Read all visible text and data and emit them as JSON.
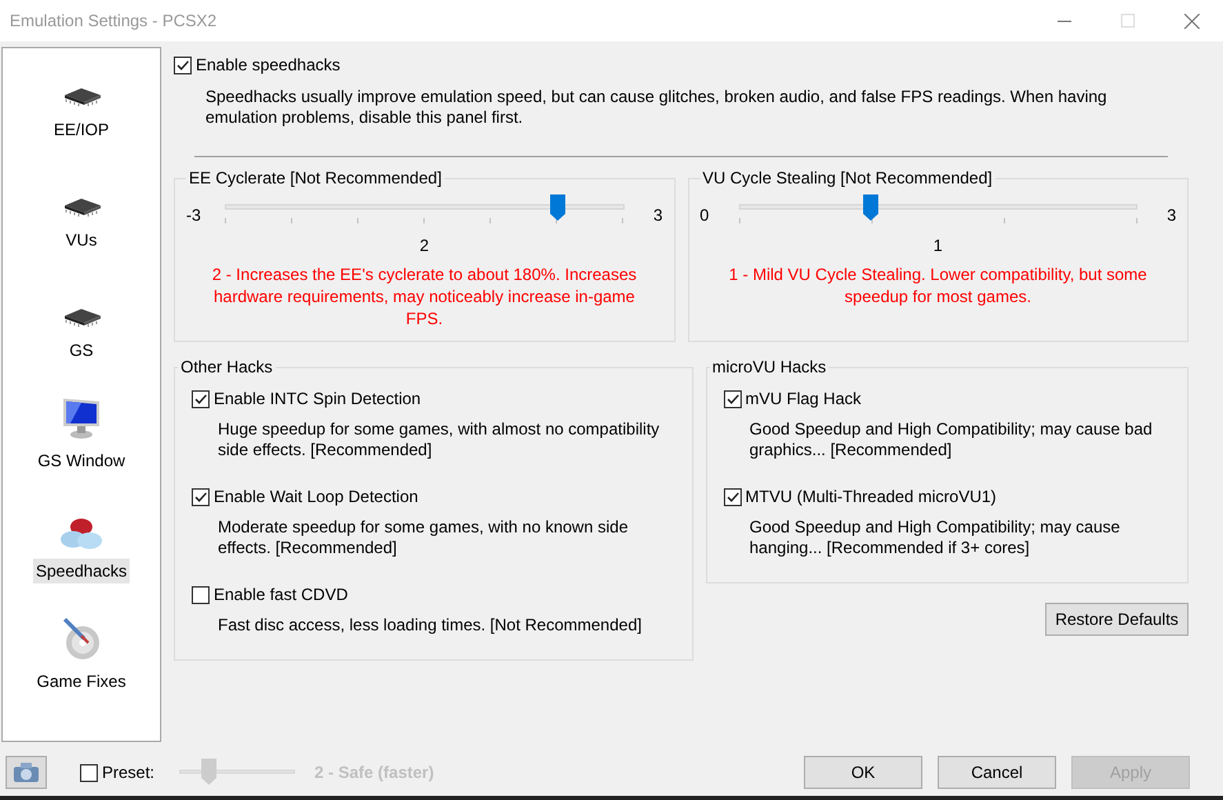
{
  "window": {
    "title": "Emulation Settings - PCSX2"
  },
  "sidebar": {
    "items": [
      {
        "label": "EE/IOP",
        "kind": "chip",
        "selected": false
      },
      {
        "label": "VUs",
        "kind": "chip",
        "selected": false
      },
      {
        "label": "GS",
        "kind": "chip",
        "selected": false
      },
      {
        "label": "GS Window",
        "kind": "monitor",
        "selected": false
      },
      {
        "label": "Speedhacks",
        "kind": "pills",
        "selected": true
      },
      {
        "label": "Game Fixes",
        "kind": "disc",
        "selected": false
      }
    ]
  },
  "enable_speedhacks": {
    "label": "Enable speedhacks",
    "checked": true,
    "description": "Speedhacks usually improve emulation speed, but can cause glitches, broken audio, and false FPS readings.  When having emulation problems, disable this panel first."
  },
  "sliders": [
    {
      "title": "EE Cyclerate [Not Recommended]",
      "min_label": "-3",
      "max_label": "3",
      "value_label": "2",
      "level": 0.833,
      "description": "2 - Increases the EE's cyclerate to about 180%. Increases hardware requirements, may noticeably increase in-game FPS."
    },
    {
      "title": "VU Cycle Stealing [Not Recommended]",
      "min_label": "0",
      "max_label": "3",
      "value_label": "1",
      "level": 0.333,
      "description": "1 - Mild VU Cycle Stealing.  Lower compatibility, but some speedup for most games."
    }
  ],
  "other_hacks": {
    "title": "Other Hacks",
    "items": [
      {
        "label": "Enable INTC Spin Detection",
        "checked": true,
        "description": "Huge speedup for some games, with almost no compatibility side effects. [Recommended]"
      },
      {
        "label": "Enable Wait Loop Detection",
        "checked": true,
        "description": "Moderate speedup for some games, with no known side effects. [Recommended]"
      },
      {
        "label": "Enable fast CDVD",
        "checked": false,
        "description": "Fast disc access, less loading times. [Not Recommended]"
      }
    ]
  },
  "microvu_hacks": {
    "title": "microVU Hacks",
    "items": [
      {
        "label": "mVU Flag Hack",
        "checked": true,
        "description": "Good Speedup and High Compatibility; may cause bad graphics... [Recommended]"
      },
      {
        "label": "MTVU (Multi-Threaded microVU1)",
        "checked": true,
        "description": "Good Speedup and High Compatibility; may cause hanging... [Recommended if 3+ cores]"
      }
    ]
  },
  "restore_defaults": "Restore Defaults",
  "preset": {
    "label": "Preset:",
    "checked": false,
    "level": 0.25,
    "value_label": "2 - Safe (faster)",
    "disabled": true
  },
  "buttons": [
    {
      "label": "OK",
      "disabled": false
    },
    {
      "label": "Cancel",
      "disabled": false
    },
    {
      "label": "Apply",
      "disabled": true
    }
  ]
}
